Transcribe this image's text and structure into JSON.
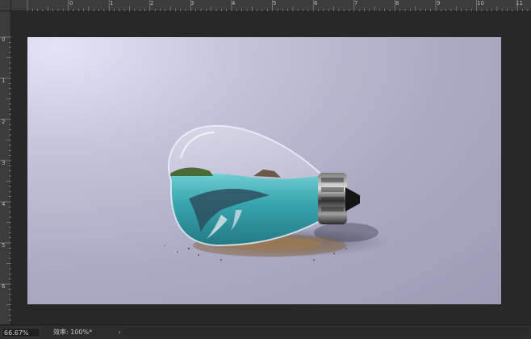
{
  "rulers": {
    "top_labels": [
      "0",
      "1",
      "2",
      "3",
      "4",
      "5",
      "6",
      "7",
      "8",
      "9",
      "10",
      "11"
    ],
    "left_labels": [
      "0",
      "1",
      "2",
      "3",
      "4",
      "5",
      "6"
    ]
  },
  "canvas": {
    "description_colors": {
      "background_light": "#e4e4f8",
      "background_dark": "#9c9cb8",
      "water": "#3aa7b0",
      "sand": "#8a6a46"
    }
  },
  "statusbar": {
    "zoom": "66.67%",
    "efficiency": "效率: 100%*",
    "arrow": "›"
  },
  "icons": {
    "status_arrow": "chevron-right-icon"
  }
}
